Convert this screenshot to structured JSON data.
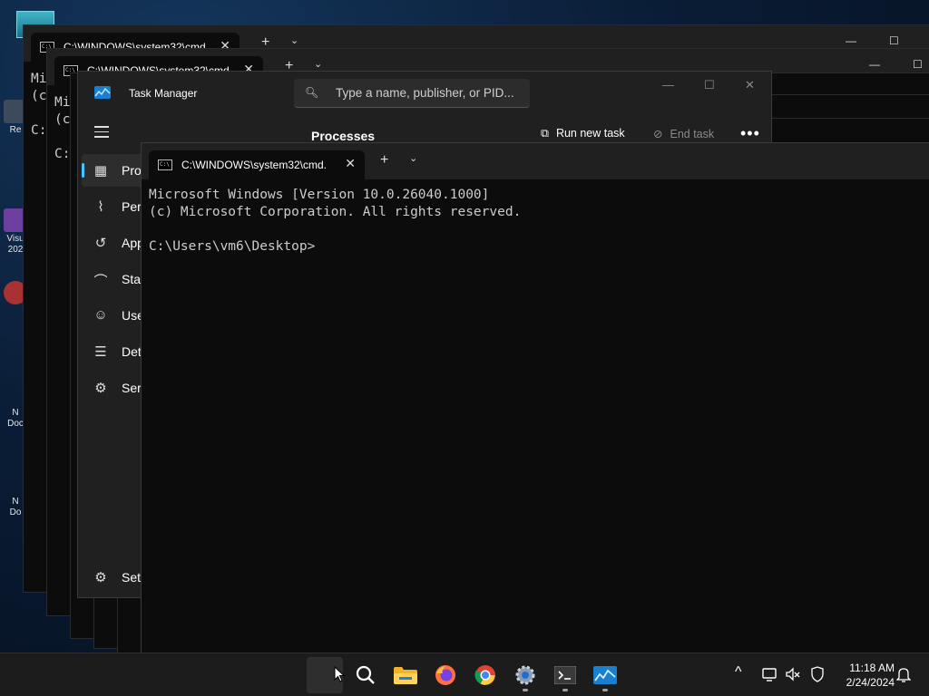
{
  "desktop": {
    "icons": [
      "Re",
      "Visu\n202",
      "N\nDoc",
      "N\nDo"
    ]
  },
  "bg_windows": [
    {
      "tab_title": "C:\\WINDOWS\\system32\\cmd.",
      "lines": "Mi\n(c\n\nC:"
    },
    {
      "tab_title": "C:\\WINDOWS\\system32\\cmd.",
      "lines": "Mi\n(c\n\nC:"
    }
  ],
  "task_manager": {
    "title": "Task Manager",
    "search_placeholder": "Type a name, publisher, or PID...",
    "window_controls": [
      "—",
      "☐",
      "✕"
    ],
    "section_title": "Processes",
    "run_new_task": "Run new task",
    "end_task": "End task",
    "more": "•••",
    "nav": [
      {
        "label": "Processes",
        "icon": "processes-icon",
        "active": true
      },
      {
        "label": "Performance",
        "icon": "performance-icon"
      },
      {
        "label": "App history",
        "icon": "app-history-icon"
      },
      {
        "label": "Startup apps",
        "icon": "startup-icon"
      },
      {
        "label": "Users",
        "icon": "users-icon"
      },
      {
        "label": "Details",
        "icon": "details-icon"
      },
      {
        "label": "Services",
        "icon": "services-icon"
      }
    ],
    "settings": "Settings"
  },
  "terminal": {
    "tab_title": "C:\\WINDOWS\\system32\\cmd.",
    "close": "✕",
    "new_tab": "+",
    "dropdown": "⌄",
    "output": "Microsoft Windows [Version 10.0.26040.1000]\n(c) Microsoft Corporation. All rights reserved.\n\nC:\\Users\\vm6\\Desktop>"
  },
  "taskbar": {
    "apps": [
      "start",
      "search",
      "file-explorer",
      "firefox",
      "chrome",
      "settings",
      "terminal",
      "task-manager"
    ],
    "tray_up": "^",
    "time": "11:18 AM",
    "date": "2/24/2024"
  },
  "colors": {
    "accent": "#4cc2ff",
    "terminal_bg": "#0c0c0c",
    "chrome_bg": "#202020"
  }
}
